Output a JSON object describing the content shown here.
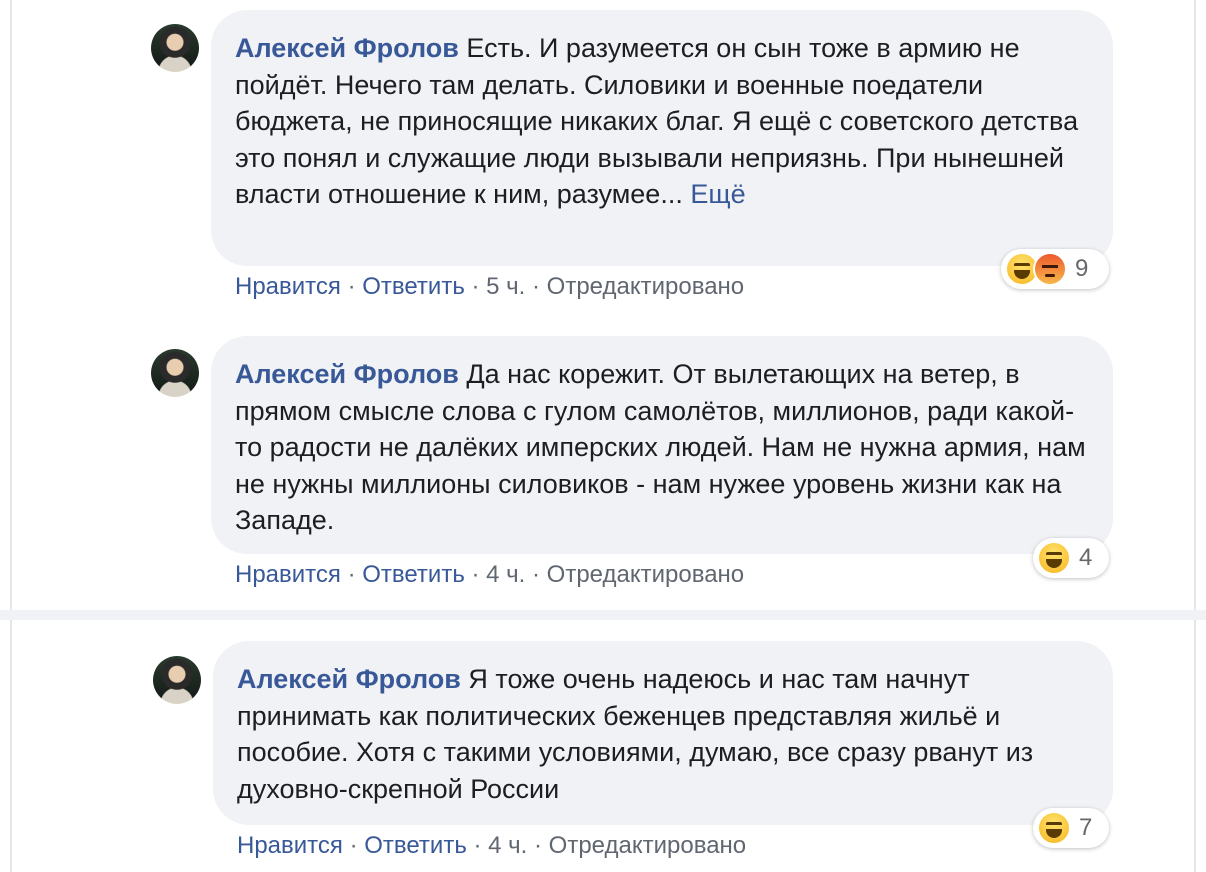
{
  "comments": [
    {
      "author": "Алексей Фролов",
      "text": "Есть. И разумеется он сын тоже в армию не пойдёт. Нечего там делать. Силовики и военные поедатели бюджета, не приносящие никаких благ. Я ещё с советского детства это понял и служащие люди вызывали неприязнь. При нынешней власти отношение к ним, разумее...",
      "more_label": "Ещё",
      "like_label": "Нравится",
      "reply_label": "Ответить",
      "time": "5 ч.",
      "edited_label": "Отредактировано",
      "reaction_count": "9",
      "reactions": [
        "haha-emoji-icon",
        "angry-emoji-icon"
      ]
    },
    {
      "author": "Алексей Фролов",
      "text": "Да нас корежит. От вылетающих на ветер, в прямом смысле слова с гулом самолётов, миллионов, ради какой-то радости не далёких имперских людей. Нам не нужна армия, нам не нужны миллионы силовиков - нам нужее уровень жизни как на Западе.",
      "like_label": "Нравится",
      "reply_label": "Ответить",
      "time": "4 ч.",
      "edited_label": "Отредактировано",
      "reaction_count": "4",
      "reactions": [
        "haha-emoji-icon"
      ]
    },
    {
      "author": "Алексей Фролов",
      "text": "Я тоже очень надеюсь и нас там начнут принимать как политических беженцев представляя жильё и пособие. Хотя с такими условиями, думаю, все сразу рванут из духовно-скрепной России",
      "like_label": "Нравится",
      "reply_label": "Ответить",
      "time": "4 ч.",
      "edited_label": "Отредактировано",
      "reaction_count": "7",
      "reactions": [
        "haha-emoji-icon"
      ]
    }
  ],
  "separator": " · ",
  "colors": {
    "link": "#385898",
    "bubble": "#f0f2f5",
    "meta": "#606770"
  }
}
